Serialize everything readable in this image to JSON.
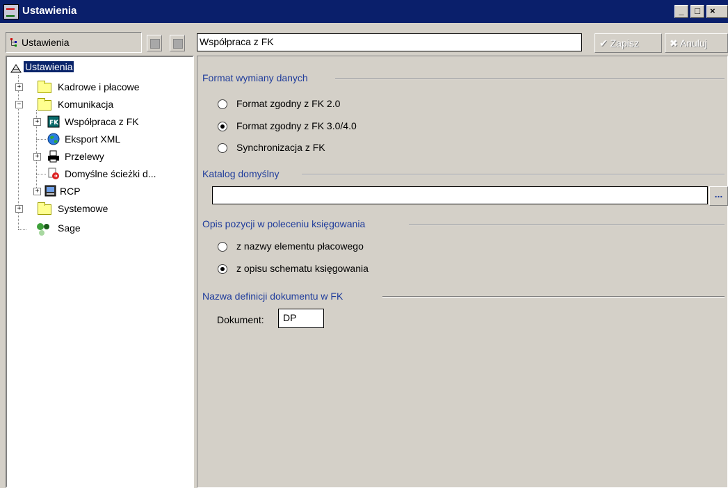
{
  "window": {
    "title": "Ustawienia",
    "min_label": "_",
    "max_label": "□",
    "close_label": "×"
  },
  "tree_header": {
    "label": "Ustawienia"
  },
  "tree": {
    "root": "Ustawienia",
    "kadrowe": "Kadrowe i płacowe",
    "komunikacja": "Komunikacja",
    "wspolpraca": "Współpraca z FK",
    "eksport": "Eksport XML",
    "przelewy": "Przelewy",
    "sciezki": "Domyślne ścieżki d...",
    "rcp": "RCP",
    "systemowe": "Systemowe",
    "sage": "Sage"
  },
  "content": {
    "path": "Współpraca z FK",
    "save_label": "Zapisz",
    "cancel_label": "Anuluj",
    "format_group": {
      "title": "Format wymiany danych",
      "options": [
        "Format zgodny z FK 2.0",
        "Format zgodny z FK 3.0/4.0",
        "Synchronizacja z FK"
      ],
      "selected": 1
    },
    "catalog_group": {
      "title": "Katalog domyślny",
      "value": "",
      "browse_label": "..."
    },
    "opis_group": {
      "title": "Opis pozycji w poleceniu księgowania",
      "options": [
        "z nazwy elementu płacowego",
        "z opisu schematu księgowania"
      ],
      "selected": 1
    },
    "doc_group": {
      "title": "Nazwa definicji dokumentu w FK",
      "label": "Dokument:",
      "value": "DP"
    }
  },
  "colors": {
    "titlebar": "#0a1f6b",
    "accent_text": "#1f3c9b",
    "face": "#d4d0c8"
  }
}
